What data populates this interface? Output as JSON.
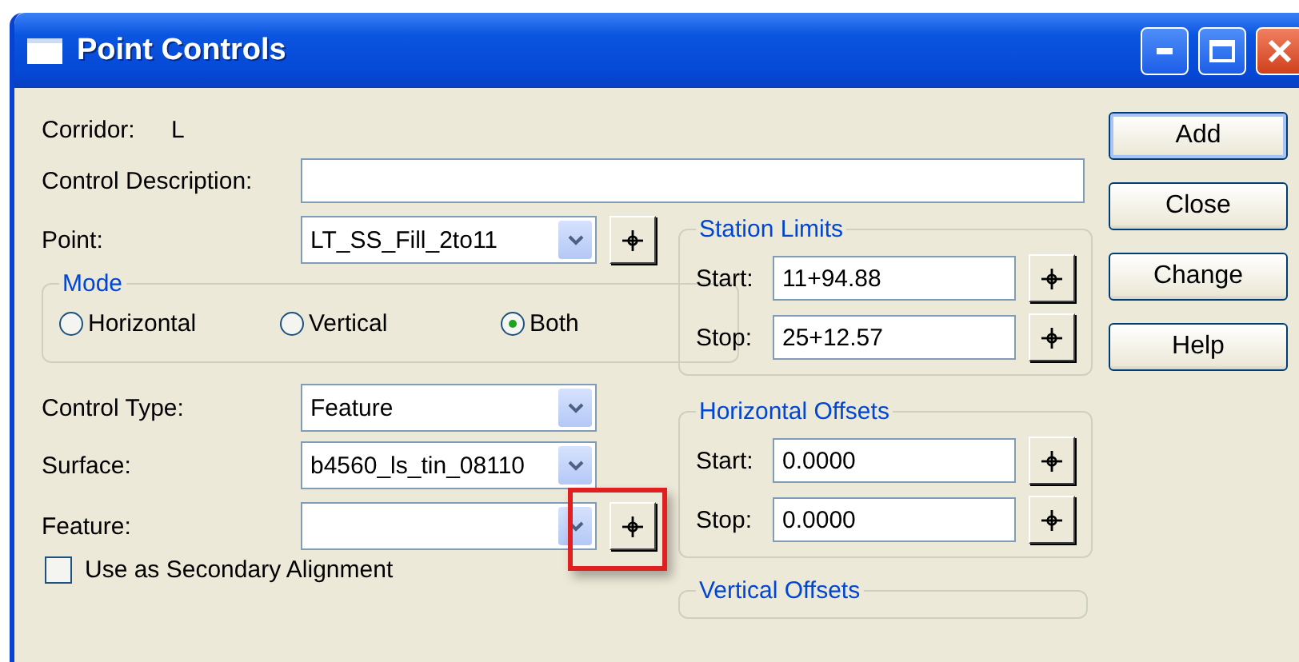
{
  "window": {
    "title": "Point Controls"
  },
  "corridor": {
    "label": "Corridor:",
    "value": "L"
  },
  "description": {
    "label": "Control Description:"
  },
  "point": {
    "label": "Point:",
    "value": "LT_SS_Fill_2to11"
  },
  "mode": {
    "title": "Mode",
    "options": [
      {
        "label": "Horizontal",
        "selected": false
      },
      {
        "label": "Vertical",
        "selected": false
      },
      {
        "label": "Both",
        "selected": true
      }
    ]
  },
  "control_type": {
    "label": "Control Type:",
    "value": "Feature"
  },
  "surface": {
    "label": "Surface:",
    "value": "b4560_ls_tin_08110"
  },
  "feature": {
    "label": "Feature:"
  },
  "secondary_alignment": {
    "label": "Use as Secondary Alignment",
    "checked": false
  },
  "station_limits": {
    "title": "Station Limits",
    "start": {
      "label": "Start:",
      "value": "11+94.88"
    },
    "stop": {
      "label": "Stop:",
      "value": "25+12.57"
    }
  },
  "horizontal_offsets": {
    "title": "Horizontal Offsets",
    "start": {
      "label": "Start:",
      "value": "0.0000"
    },
    "stop": {
      "label": "Stop:",
      "value": "0.0000"
    }
  },
  "vertical_offsets": {
    "title": "Vertical Offsets"
  },
  "buttons": [
    {
      "label": "Add",
      "default": true
    },
    {
      "label": "Close",
      "default": false
    },
    {
      "label": "Change",
      "default": false
    },
    {
      "label": "Help",
      "default": false
    }
  ]
}
